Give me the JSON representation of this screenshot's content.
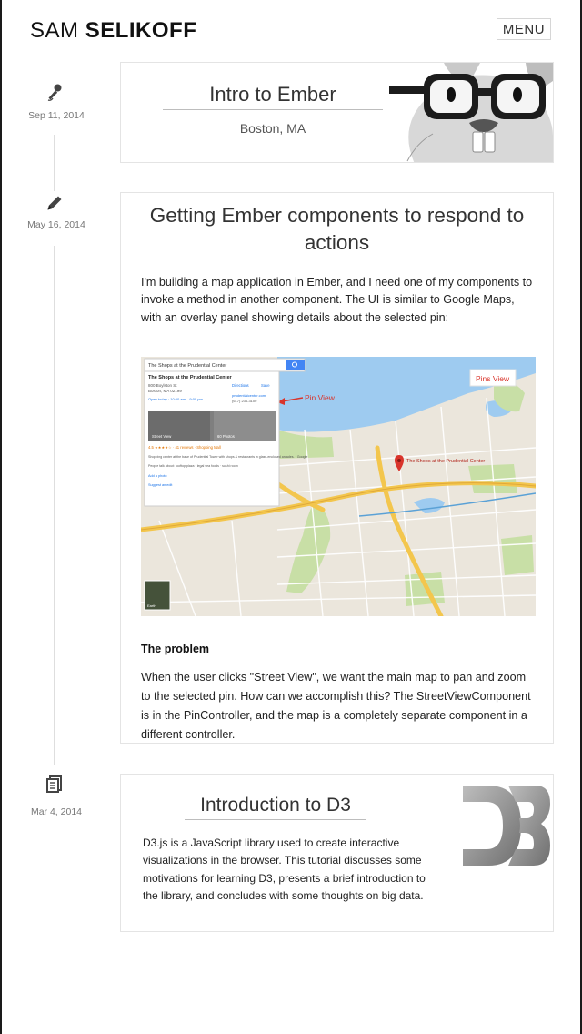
{
  "header": {
    "logo_first": "SAM",
    "logo_last": "SELIKOFF",
    "menu_label": "MENU"
  },
  "timeline": [
    {
      "date": "Sep 11, 2014",
      "icon": "microphone-icon"
    },
    {
      "date": "May 16, 2014",
      "icon": "pencil-icon"
    },
    {
      "date": "Mar 4, 2014",
      "icon": "document-icon"
    }
  ],
  "talk": {
    "title": "Intro to Ember",
    "location": "Boston, MA"
  },
  "post": {
    "title": "Getting Ember components to respond to actions",
    "intro": "I'm building a map application in Ember, and I need one of my components to invoke a method in another component. The UI is similar to Google Maps, with an overlay panel showing details about the selected pin:",
    "map": {
      "search_text": "The Shops at the Prudential Center",
      "place_name": "The Shops at the Prudential Center",
      "address_line1": "800 Boylston St",
      "address_line2": "Boston, MA 02199",
      "directions": "Directions",
      "save": "Save",
      "website": "prudentialcenter.com",
      "phone": "(617) 236-3100",
      "hours": "Open today · 10:00 am – 9:00 pm",
      "street_view": "Street View",
      "photos": "60 Photos",
      "rating": "4.5 ★★★★☆ · 41 reviews · Shopping Mall",
      "description": "Shopping center at the base of Prudential Tower with shops & restaurants in glass-enclosed arcades. · Google",
      "people_talk": "People talk about: rooftop plaza · legal sea foods · sushi room",
      "add_photo": "Add a photo",
      "suggest_edit": "Suggest an edit",
      "pin_view_label": "Pin View",
      "pins_view_label": "Pins View",
      "pin_label": "The Shops at the Prudential Center",
      "earth": "Earth"
    },
    "heading": "The problem",
    "body": "When the user clicks \"Street View\", we want the main map to pan and zoom to the selected pin. How can we accomplish this? The StreetViewComponent is in the PinController, and the map is a completely separate component in a different controller."
  },
  "d3": {
    "title": "Introduction to D3",
    "body": "D3.js is a JavaScript library used to create interactive visualizations in the browser. This tutorial discusses some motivations for learning D3, presents a brief introduction to the library, and concludes with some thoughts on big data."
  },
  "colors": {
    "map_land": "#ebe6dc",
    "map_water": "#9ecbf0",
    "map_park": "#c8dfa6",
    "map_highway": "#f3c64d",
    "annotation_red": "#d9342b",
    "google_blue": "#4285f4"
  }
}
